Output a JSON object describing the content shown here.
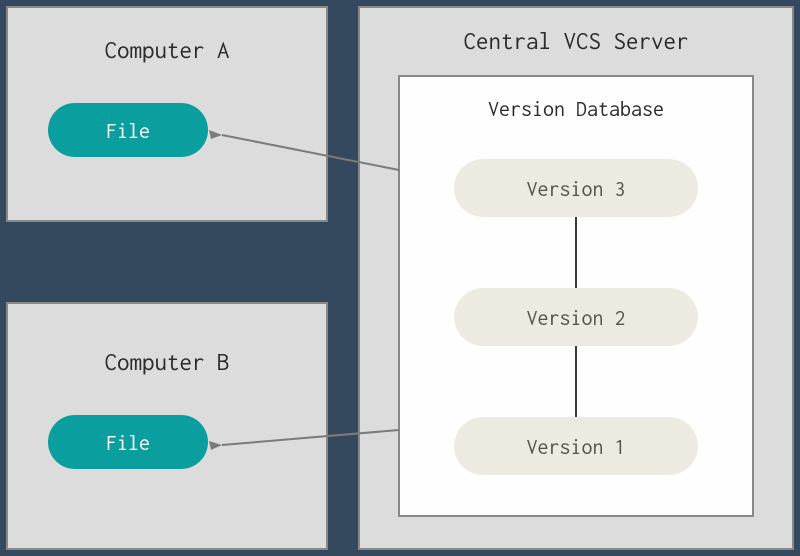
{
  "computerA": {
    "title": "Computer A",
    "file": "File"
  },
  "computerB": {
    "title": "Computer B",
    "file": "File"
  },
  "server": {
    "title": "Central VCS Server",
    "databaseTitle": "Version Database",
    "versions": [
      "Version 3",
      "Version 2",
      "Version 1"
    ]
  }
}
